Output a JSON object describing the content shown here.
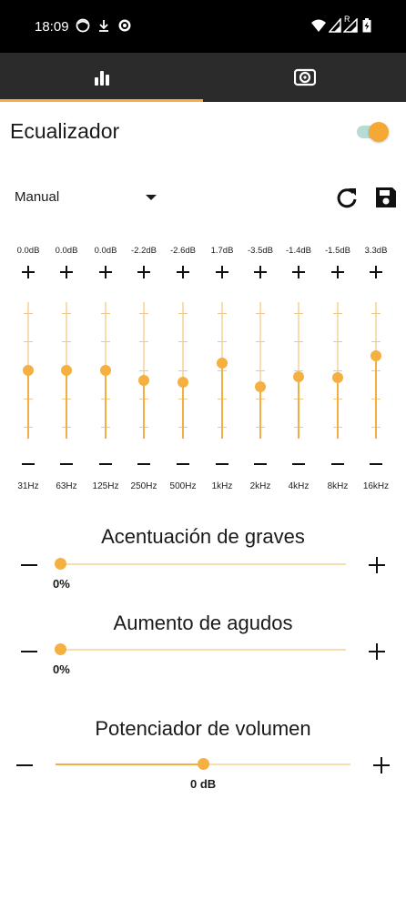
{
  "status_bar": {
    "time": "18:09",
    "left_icons": [
      "face-notification-icon",
      "download-icon",
      "target-icon"
    ],
    "right_icons": [
      "wifi-icon",
      "signal-icon",
      "signal-roaming-icon",
      "battery-charging-icon"
    ],
    "roaming_letter": "R"
  },
  "tabs": [
    {
      "name": "equalizer",
      "icon": "equalizer-bars-icon",
      "selected": true
    },
    {
      "name": "volume",
      "icon": "speaker-icon",
      "selected": false
    }
  ],
  "accent_color": "#f5b041",
  "header": {
    "title": "Ecualizador",
    "enabled": true
  },
  "preset": {
    "selected": "Manual"
  },
  "bands": [
    {
      "freq": "31Hz",
      "db_label": "0.0dB",
      "level": 0.0
    },
    {
      "freq": "63Hz",
      "db_label": "0.0dB",
      "level": 0.0
    },
    {
      "freq": "125Hz",
      "db_label": "0.0dB",
      "level": 0.0
    },
    {
      "freq": "250Hz",
      "db_label": "-2.2dB",
      "level": -2.2
    },
    {
      "freq": "500Hz",
      "db_label": "-2.6dB",
      "level": -2.6
    },
    {
      "freq": "1kHz",
      "db_label": "1.7dB",
      "level": 1.7
    },
    {
      "freq": "2kHz",
      "db_label": "-3.5dB",
      "level": -3.5
    },
    {
      "freq": "4kHz",
      "db_label": "-1.4dB",
      "level": -1.4
    },
    {
      "freq": "8kHz",
      "db_label": "-1.5dB",
      "level": -1.5
    },
    {
      "freq": "16kHz",
      "db_label": "3.3dB",
      "level": 3.3
    }
  ],
  "band_range_db": [
    -15,
    15
  ],
  "bass": {
    "title": "Acentuación de graves",
    "value_label": "0%",
    "fraction": 0.0
  },
  "treble": {
    "title": "Aumento de agudos",
    "value_label": "0%",
    "fraction": 0.0
  },
  "volume": {
    "title": "Potenciador de volumen",
    "value_label": "0 dB",
    "fraction": 0.5
  }
}
